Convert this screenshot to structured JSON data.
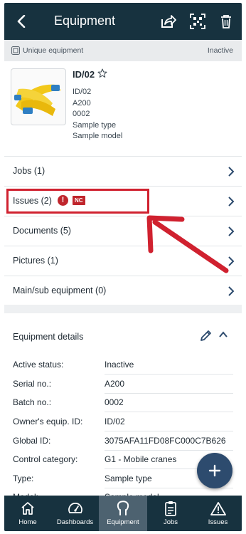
{
  "header": {
    "title": "Equipment"
  },
  "subheader": {
    "label": "Unique equipment",
    "status": "Inactive"
  },
  "equipment": {
    "name": "ID/02",
    "lines": [
      "ID/02",
      "A200",
      "0002",
      "Sample type",
      "Sample model"
    ]
  },
  "list": [
    {
      "label": "Jobs (1)"
    },
    {
      "label": "Issues (2)",
      "badge": "NC"
    },
    {
      "label": "Documents (5)"
    },
    {
      "label": "Pictures (1)"
    },
    {
      "label": "Main/sub equipment (0)"
    }
  ],
  "details": {
    "title": "Equipment details",
    "rows": [
      {
        "key": "Active status:",
        "value": "Inactive"
      },
      {
        "key": "Serial no.:",
        "value": "A200"
      },
      {
        "key": "Batch no.:",
        "value": "0002"
      },
      {
        "key": "Owner's equip. ID:",
        "value": "ID/02"
      },
      {
        "key": "Global ID:",
        "value": "3075AFA11FD08FC000C7B626"
      },
      {
        "key": "Control category:",
        "value": "G1 - Mobile cranes"
      },
      {
        "key": "Type:",
        "value": "Sample type"
      },
      {
        "key": "Model:",
        "value": "Sample model"
      }
    ]
  },
  "nav": [
    {
      "label": "Home",
      "icon": "home-icon"
    },
    {
      "label": "Dashboards",
      "icon": "speedometer-icon"
    },
    {
      "label": "Equipment",
      "icon": "equipment-hook-icon",
      "active": true
    },
    {
      "label": "Jobs",
      "icon": "clipboard-icon"
    },
    {
      "label": "Issues",
      "icon": "warning-icon"
    }
  ],
  "colors": {
    "header_bg": "#17323f",
    "alert_red": "#c0262d",
    "fab_bg": "#2d4b6e",
    "nav_active": "#4d6270"
  }
}
